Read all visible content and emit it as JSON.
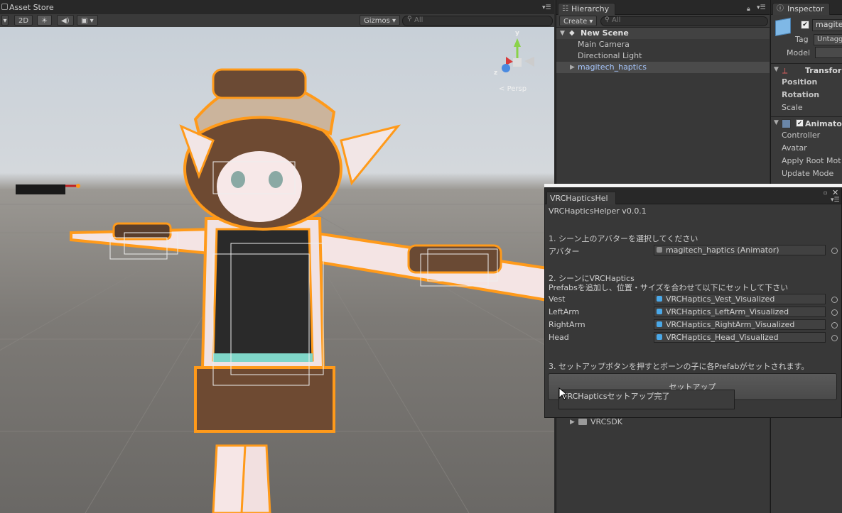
{
  "scene_panel": {
    "tab_label": "Asset Store",
    "toolbar": {
      "mode_2d": "2D",
      "gizmos": "Gizmos",
      "search_placeholder": "All"
    },
    "persp_label": "Persp",
    "gizmo_axes": {
      "y": "y",
      "z": "z"
    }
  },
  "hierarchy": {
    "tab_label": "Hierarchy",
    "create_label": "Create",
    "search_placeholder": "All",
    "scene_name": "New Scene",
    "items": [
      {
        "label": "Main Camera"
      },
      {
        "label": "Directional Light"
      },
      {
        "label": "magitech_haptics"
      },
      {
        "label": "VRCSDK"
      }
    ]
  },
  "inspector": {
    "tab_label": "Inspector",
    "object_name": "magite",
    "tag_label": "Tag",
    "tag_value": "Untagg",
    "model_label": "Model",
    "transform": {
      "title": "Transfor",
      "position": "Position",
      "rotation": "Rotation",
      "scale": "Scale"
    },
    "animator": {
      "title": "Animator",
      "controller": "Controller",
      "avatar": "Avatar",
      "apply_root": "Apply Root Mot",
      "update_mode": "Update Mode"
    }
  },
  "vrc_helper": {
    "tab_label": "VRCHapticsHel",
    "title": "VRCHapticsHelper v0.0.1",
    "step1": "1. シーン上のアバターを選択してください",
    "avatar_label": "アバター",
    "avatar_value": "magitech_haptics (Animator)",
    "step2_line1": "2. シーンにVRCHaptics",
    "step2_line2": "Prefabsを追加し、位置・サイズを合わせて以下にセットして下さい",
    "fields": [
      {
        "label": "Vest",
        "value": "VRCHaptics_Vest_Visualized"
      },
      {
        "label": "LeftArm",
        "value": "VRCHaptics_LeftArm_Visualized"
      },
      {
        "label": "RightArm",
        "value": "VRCHaptics_RightArm_Visualized"
      },
      {
        "label": "Head",
        "value": "VRCHaptics_Head_Visualized"
      }
    ],
    "step3": "3. セットアップボタンを押すとボーンの子に各Prefabがセットされます。",
    "setup_button": "セットアップ",
    "tooltip": "VRCHapticsセットアップ完了"
  },
  "colors": {
    "selection_outline": "#ff9a1a",
    "accent_blue": "#4aa8e8",
    "panel_bg": "#383838"
  }
}
